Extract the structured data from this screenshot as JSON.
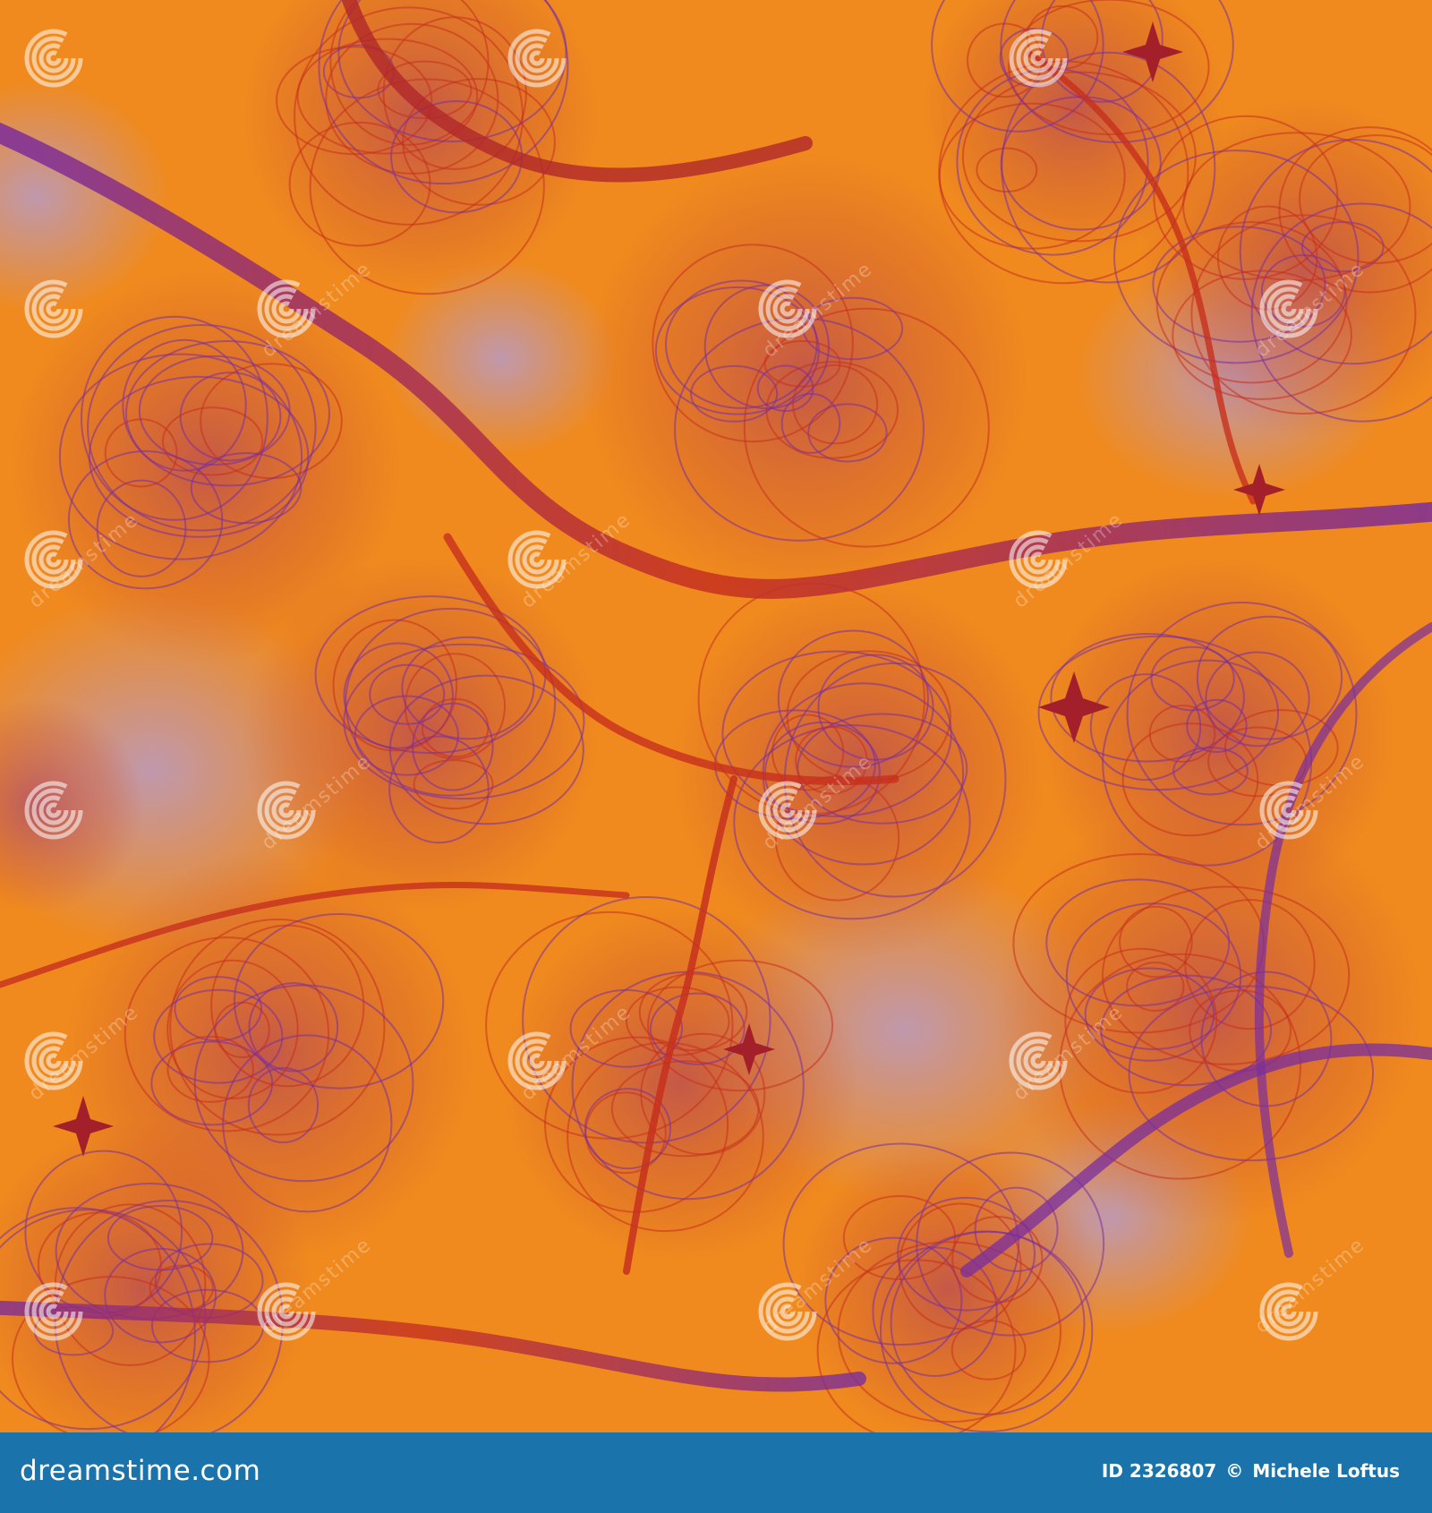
{
  "image": {
    "subject": "abstract fractal",
    "colors": {
      "background_orange": "#f08a1e",
      "haze_lavender": "#b79bc6",
      "branch_red": "#c7301d",
      "branch_purple": "#7a2d9e",
      "watermark_white": "#ffffff",
      "footer_blue": "#1a74ab"
    }
  },
  "watermark": {
    "text": "dreamstime",
    "icon": "swirl-logo-icon"
  },
  "footer": {
    "brand_name": "dreamstime",
    "brand_tld": ".com",
    "id_label": "ID 2326807",
    "copyright_symbol": "©",
    "author": "Michele Loftus"
  }
}
